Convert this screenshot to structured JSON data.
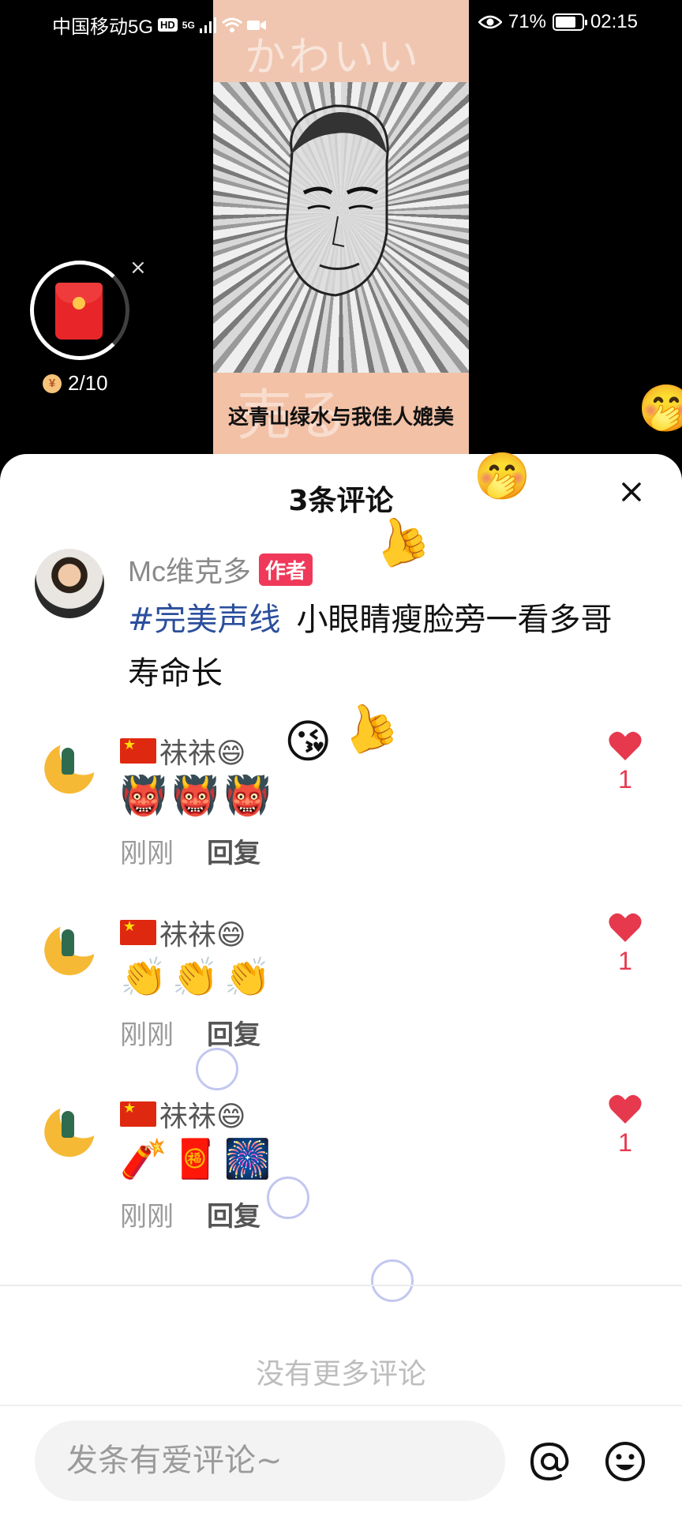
{
  "status_bar": {
    "carrier": "中国移动5G",
    "hd": "HD",
    "net": "5G",
    "battery": "71%",
    "time": "02:15"
  },
  "video": {
    "caption": "这青山绿水与我佳人媲美",
    "top_deco_text": "かわいい"
  },
  "red_packet": {
    "coin_symbol": "¥",
    "progress": "2/10",
    "close": "×"
  },
  "sheet": {
    "title": "3条评论",
    "close": "×"
  },
  "author_post": {
    "name": "Mc维克多",
    "badge": "作者",
    "hashtag": "#完美声线",
    "text": "小眼睛瘦脸旁一看多哥寿命长"
  },
  "comments": [
    {
      "name": "祙祙😄",
      "body": "👹👹👹",
      "time": "刚刚",
      "reply": "回复",
      "likes": "1"
    },
    {
      "name": "祙祙😄",
      "body": "👏👏👏",
      "time": "刚刚",
      "reply": "回复",
      "likes": "1"
    },
    {
      "name": "祙祙😄",
      "body": "🧨🧧🎆",
      "time": "刚刚",
      "reply": "回复",
      "likes": "1"
    }
  ],
  "no_more": "没有更多评论",
  "input": {
    "placeholder": "发条有爱评论~"
  },
  "floating_emojis": [
    "🤭",
    "🤭",
    "👍",
    "😘",
    "👍"
  ],
  "colors": {
    "like_red": "#e6394e",
    "author_badge": "#f0395a",
    "hashtag_blue": "#2b4f9c"
  }
}
